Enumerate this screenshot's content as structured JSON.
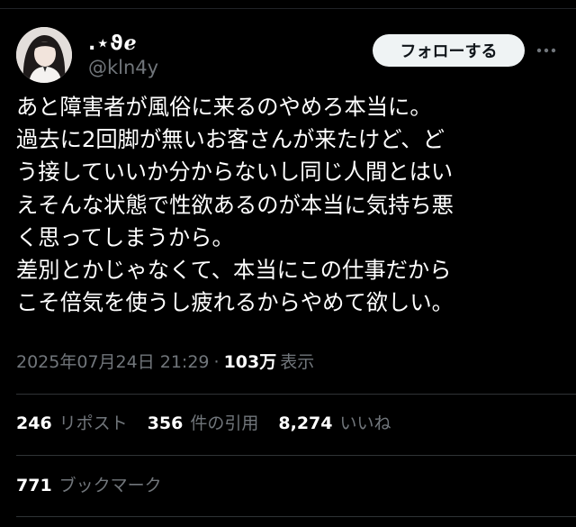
{
  "author": {
    "display_name": ".⋆ϑℯ",
    "handle": "@kln4y"
  },
  "follow_label": "フォローする",
  "more_icon": "more-horizontal-icon",
  "tweet": {
    "lines": [
      "あと障害者が風俗に来るのやめろ本当に。",
      "過去に2回脚が無いお客さんが来たけど、ど",
      "う接していいか分からないし同じ人間とはい",
      "えそんな状態で性欲あるのが本当に気持ち悪",
      "く思ってしまうから。",
      "差別とかじゃなくて、本当にこの仕事だから",
      "こそ倍気を使うし疲れるからやめて欲しい。"
    ]
  },
  "meta": {
    "datetime": "2025年07月24日 21:29",
    "separator": "·",
    "views_count": "103万",
    "views_label": "表示"
  },
  "stats": {
    "reposts": {
      "count": "246",
      "label": "リポスト"
    },
    "quotes": {
      "count": "356",
      "label": "件の引用"
    },
    "likes": {
      "count": "8,274",
      "label": "いいね"
    },
    "bookmarks": {
      "count": "771",
      "label": "ブックマーク"
    }
  }
}
